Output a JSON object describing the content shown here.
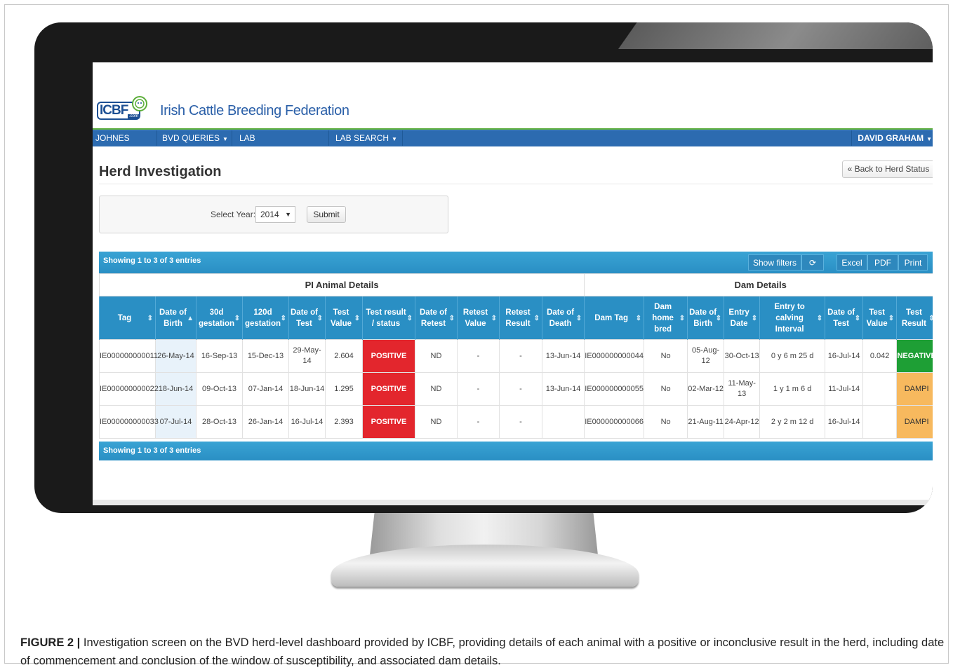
{
  "header": {
    "logo_text": "ICBF",
    "logo_sub": ".com",
    "site_title": "Irish Cattle Breeding Federation"
  },
  "nav": {
    "items": [
      "JOHNES RAMP",
      "BVD QUERIES",
      "LAB TURNAROUND",
      "LAB SEARCH"
    ],
    "user": "DAVID GRAHAM"
  },
  "page": {
    "title": "Herd Investigation",
    "back_button": "« Back to Herd Status"
  },
  "filter": {
    "year_label": "Select Year:",
    "year_value": "2014",
    "submit_label": "Submit"
  },
  "table": {
    "info_top": "Showing 1 to 3 of 3 entries",
    "info_bottom": "Showing 1 to 3 of 3 entries",
    "tools": {
      "show_filters": "Show filters",
      "refresh_icon": "refresh-icon",
      "excel": "Excel",
      "pdf": "PDF",
      "print": "Print"
    },
    "groups": {
      "pi": "PI Animal Details",
      "dam": "Dam Details"
    },
    "columns": [
      "Tag",
      "Date of Birth",
      "30d gestation",
      "120d gestation",
      "Date of Test",
      "Test Value",
      "Test result / status",
      "Date of Retest",
      "Retest Value",
      "Retest Result",
      "Date of Death",
      "Dam Tag",
      "Dam home bred",
      "Date of Birth",
      "Entry Date",
      "Entry to calving Interval",
      "Date of Test",
      "Test Value",
      "Test Result"
    ],
    "rows": [
      [
        "IE000000000011",
        "26-May-14",
        "16-Sep-13",
        "15-Dec-13",
        "29-May-14",
        "2.604",
        "POSITIVE",
        "ND",
        "-",
        "-",
        "13-Jun-14",
        "IE000000000044",
        "No",
        "05-Aug-12",
        "30-Oct-13",
        "0 y 6 m 25 d",
        "16-Jul-14",
        "0.042",
        "NEGATIVE"
      ],
      [
        "IE000000000022",
        "18-Jun-14",
        "09-Oct-13",
        "07-Jan-14",
        "18-Jun-14",
        "1.295",
        "POSITIVE",
        "ND",
        "-",
        "-",
        "13-Jun-14",
        "IE000000000055",
        "No",
        "02-Mar-12",
        "11-May-13",
        "1 y 1 m 6 d",
        "11-Jul-14",
        "",
        "DAMPI"
      ],
      [
        "IE000000000033",
        "07-Jul-14",
        "28-Oct-13",
        "26-Jan-14",
        "16-Jul-14",
        "2.393",
        "POSITIVE",
        "ND",
        "-",
        "-",
        "",
        "IE000000000066",
        "No",
        "21-Aug-11",
        "24-Apr-12",
        "2 y 2 m 12 d",
        "16-Jul-14",
        "",
        "DAMPI"
      ]
    ]
  },
  "caption": {
    "label": "FIGURE 2 |",
    "text": " Investigation screen on the BVD herd-level dashboard provided by ICBF, providing details of each animal with a positive or inconclusive result in the herd, including date of commencement and conclusion of the window of susceptibility, and associated dam details."
  },
  "colors": {
    "nav_blue": "#2c6bb0",
    "table_header_blue": "#2a8fc4",
    "positive_red": "#e3262d",
    "negative_green": "#1e9f35",
    "dampi_orange": "#f7b95e",
    "brand_green": "#5cae3a"
  }
}
